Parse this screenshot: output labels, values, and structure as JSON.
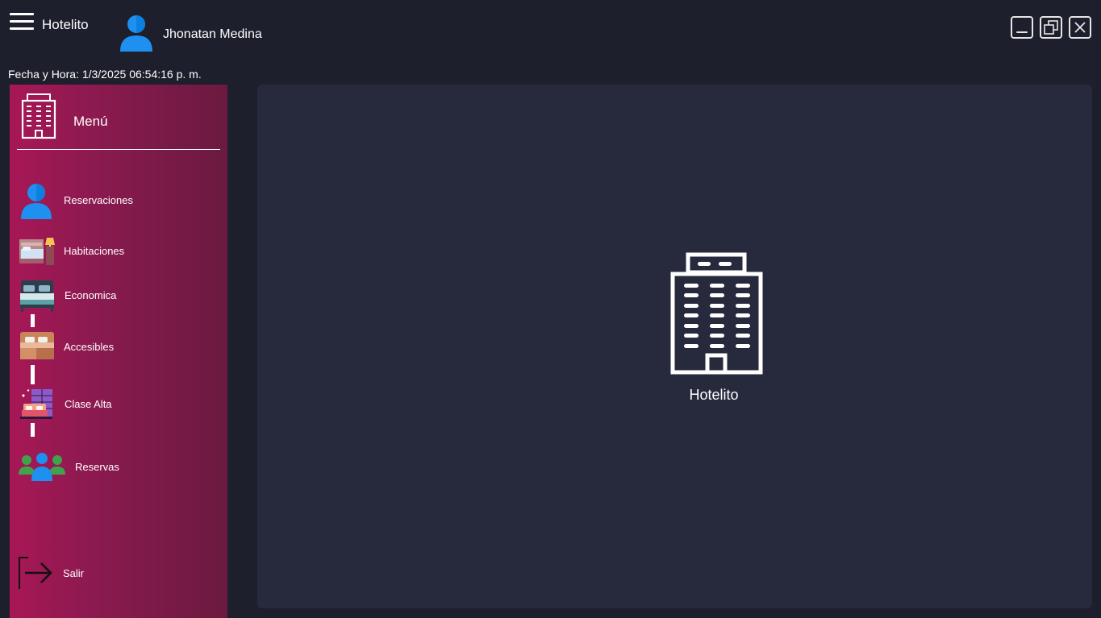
{
  "header": {
    "app_title": "Hotelito",
    "user_name": "Jhonatan Medina",
    "datetime_label": "Fecha y Hora: 1/3/2025 06:54:16 p. m."
  },
  "window_controls": {
    "minimize_icon": "minimize-icon",
    "restore_icon": "restore-icon",
    "close_icon": "close-icon"
  },
  "sidebar": {
    "title": "Menú",
    "logo_icon": "hotel-building-icon",
    "items": [
      {
        "label": "Reservaciones",
        "icon": "person-icon"
      },
      {
        "label": "Habitaciones",
        "icon": "bedroom-icon"
      },
      {
        "label": "Economica",
        "icon": "double-bed-icon"
      },
      {
        "label": "Accesibles",
        "icon": "bed-icon"
      },
      {
        "label": "Clase Alta",
        "icon": "luxury-room-icon"
      },
      {
        "label": "Reservas",
        "icon": "group-icon"
      }
    ],
    "exit_label": "Salir",
    "exit_icon": "exit-icon"
  },
  "main": {
    "caption": "Hotelito",
    "logo_icon": "hotel-building-icon"
  },
  "colors": {
    "background": "#1e1f2c",
    "panel": "#272a3d",
    "sidebar_start": "#a81756",
    "sidebar_end": "#6a1a3f",
    "avatar_blue": "#1e90f0"
  }
}
